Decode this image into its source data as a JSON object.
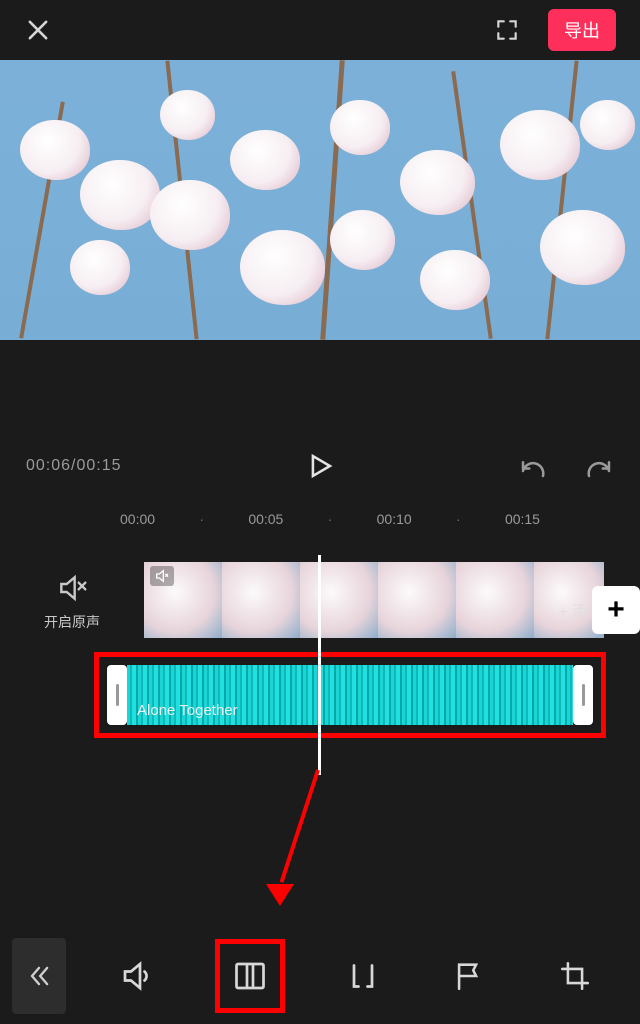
{
  "header": {
    "export_label": "导出"
  },
  "transport": {
    "current_time": "00:06",
    "total_time": "00:15"
  },
  "ruler": {
    "marks": [
      "00:00",
      "00:05",
      "00:10",
      "00:15"
    ]
  },
  "mute": {
    "label": "开启原声"
  },
  "add": {
    "label_prefix": "+ 添"
  },
  "audio": {
    "title": "Alone Together"
  }
}
